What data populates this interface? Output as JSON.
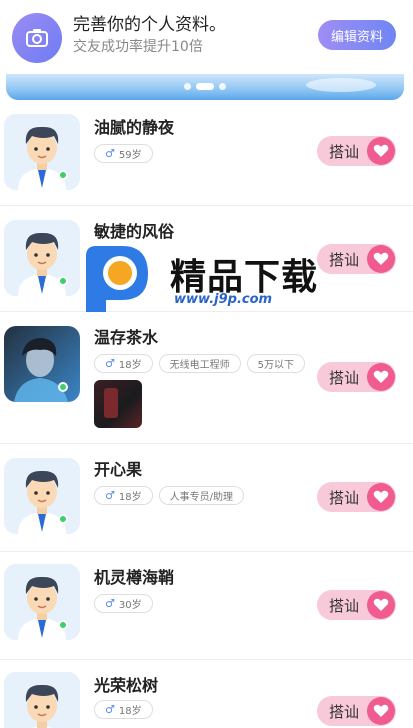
{
  "banner": {
    "title": "完善你的个人资料。",
    "subtitle": "交友成功率提升10倍",
    "edit_label": "编辑资料",
    "icon": "camera-icon"
  },
  "carousel": {
    "dot_count": 3,
    "active_index": 1
  },
  "users": [
    {
      "name": "油腻的静夜",
      "tags": [
        {
          "gender": "♂",
          "text": "59岁"
        }
      ],
      "avatar": "cartoon-avatar",
      "online": true,
      "photo": false
    },
    {
      "name": "敏捷的风俗",
      "tags": [],
      "avatar": "cartoon-avatar",
      "online": true,
      "photo": false
    },
    {
      "name": "温存茶水",
      "tags": [
        {
          "gender": "♂",
          "text": "18岁"
        },
        {
          "text": "无线电工程师"
        },
        {
          "text": "5万以下"
        }
      ],
      "avatar": "photo-avatar",
      "online": true,
      "photo": true
    },
    {
      "name": "开心果",
      "tags": [
        {
          "gender": "♂",
          "text": "18岁"
        },
        {
          "text": "人事专员/助理"
        }
      ],
      "avatar": "cartoon-avatar",
      "online": true,
      "photo": false
    },
    {
      "name": "机灵樽海鞘",
      "tags": [
        {
          "gender": "♂",
          "text": "30岁"
        }
      ],
      "avatar": "cartoon-avatar",
      "online": true,
      "photo": false
    },
    {
      "name": "光荣松树",
      "tags": [
        {
          "gender": "♂",
          "text": "18岁"
        }
      ],
      "avatar": "cartoon-avatar",
      "online": true,
      "photo": false
    }
  ],
  "greet_label": "搭讪",
  "watermark": {
    "text": "精品下载",
    "url": "www.j9p.com"
  },
  "colors": {
    "accent": "#7b86f4",
    "greet_bg": "#f8c9d8",
    "heart": "#f05c8f",
    "online": "#3ccf6b"
  }
}
